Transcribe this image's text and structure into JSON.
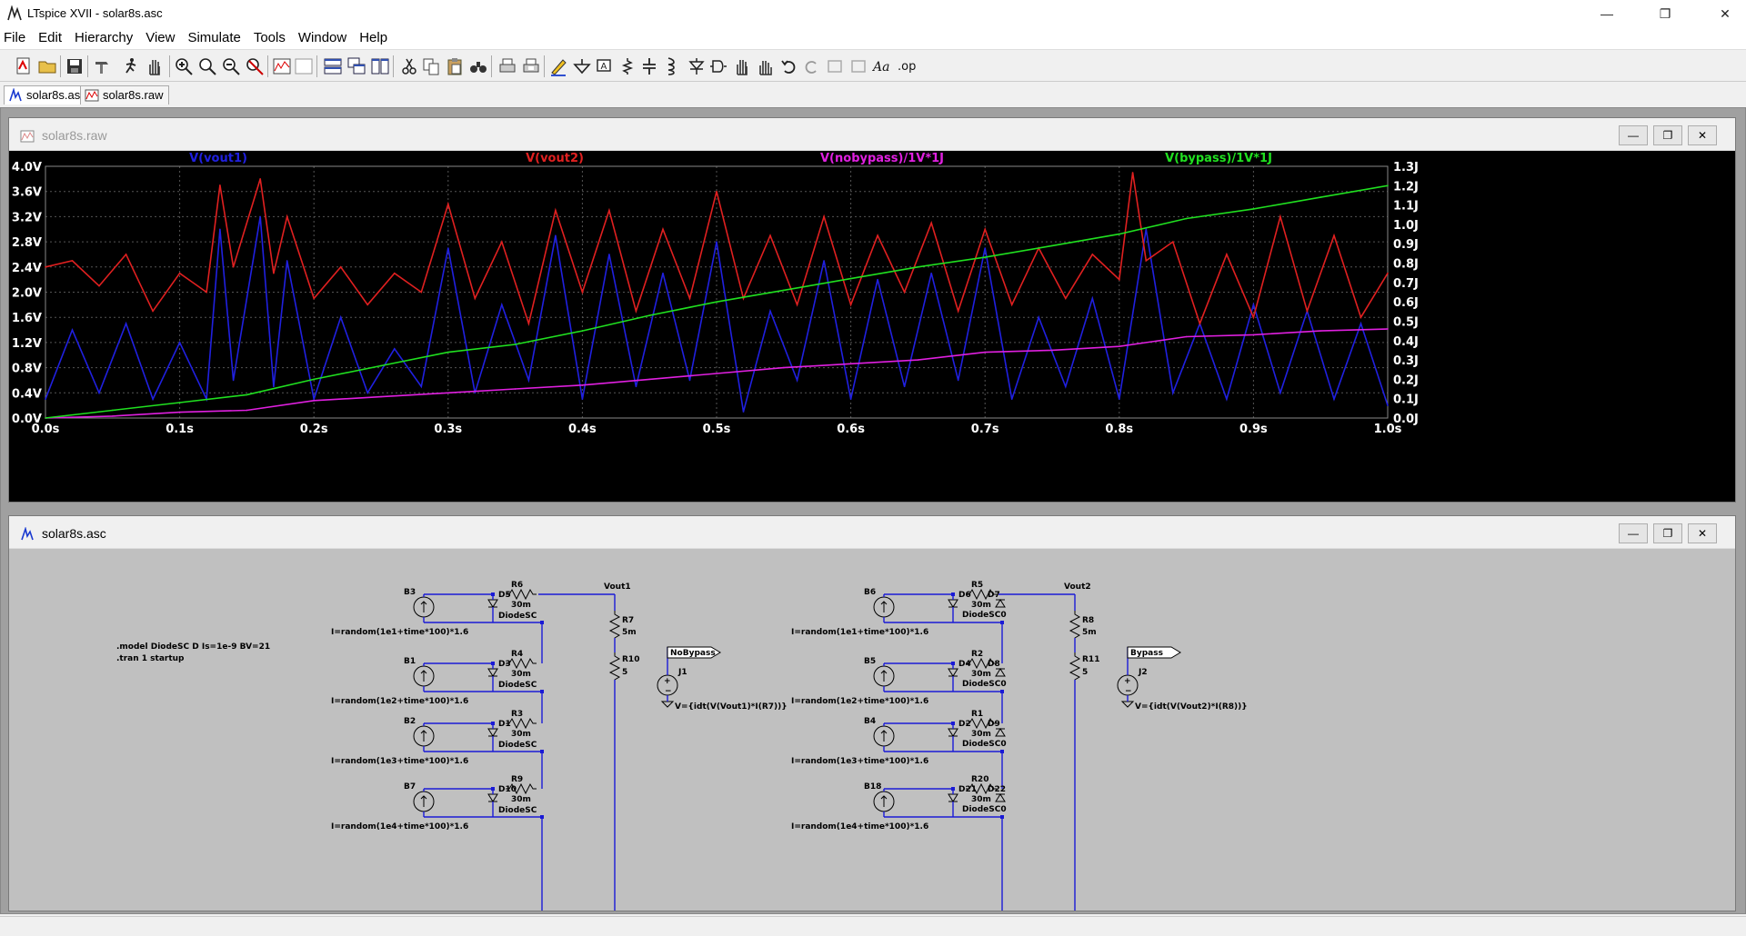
{
  "window": {
    "title": "LTspice XVII - solar8s.asc",
    "controls": {
      "minimize": "—",
      "restore": "❐",
      "close": "✕"
    }
  },
  "menu": [
    "File",
    "Edit",
    "Hierarchy",
    "View",
    "Simulate",
    "Tools",
    "Window",
    "Help"
  ],
  "tabs": [
    {
      "label": "solar8s.asc",
      "icon": "schematic-icon",
      "active": true
    },
    {
      "label": "solar8s.raw",
      "icon": "waveform-icon",
      "active": false
    }
  ],
  "plot_window": {
    "title": "solar8s.raw",
    "controls": {
      "minimize": "—",
      "restore": "❐",
      "close": "✕"
    }
  },
  "schematic_window": {
    "title": "solar8s.asc",
    "controls": {
      "minimize": "—",
      "restore": "❐",
      "close": "✕"
    }
  },
  "chart_data": {
    "type": "line",
    "x_ticks": [
      "0.0s",
      "0.1s",
      "0.2s",
      "0.3s",
      "0.4s",
      "0.5s",
      "0.6s",
      "0.7s",
      "0.8s",
      "0.9s",
      "1.0s"
    ],
    "xlim": [
      0,
      1.0
    ],
    "y_left_ticks": [
      "0.0V",
      "0.4V",
      "0.8V",
      "1.2V",
      "1.6V",
      "2.0V",
      "2.4V",
      "2.8V",
      "3.2V",
      "3.6V",
      "4.0V"
    ],
    "ylim_left": [
      0,
      4.0
    ],
    "y_right_ticks": [
      "0.0J",
      "0.1J",
      "0.2J",
      "0.3J",
      "0.4J",
      "0.5J",
      "0.6J",
      "0.7J",
      "0.8J",
      "0.9J",
      "1.0J",
      "1.1J",
      "1.2J",
      "1.3J"
    ],
    "ylim_right": [
      0,
      1.3
    ],
    "background": "#000000",
    "grid": true,
    "series": [
      {
        "name": "V(vout1)",
        "color": "#2020e0",
        "axis": "left",
        "x": [
          0,
          0.02,
          0.04,
          0.06,
          0.08,
          0.1,
          0.12,
          0.13,
          0.14,
          0.16,
          0.17,
          0.18,
          0.2,
          0.22,
          0.24,
          0.26,
          0.28,
          0.3,
          0.32,
          0.34,
          0.36,
          0.38,
          0.4,
          0.42,
          0.44,
          0.46,
          0.48,
          0.5,
          0.52,
          0.54,
          0.56,
          0.58,
          0.6,
          0.62,
          0.64,
          0.66,
          0.68,
          0.7,
          0.72,
          0.74,
          0.76,
          0.78,
          0.8,
          0.82,
          0.84,
          0.86,
          0.88,
          0.9,
          0.92,
          0.94,
          0.96,
          0.98,
          1.0
        ],
        "y": [
          0.3,
          1.4,
          0.4,
          1.5,
          0.3,
          1.2,
          0.3,
          3.0,
          0.6,
          3.2,
          0.5,
          2.5,
          0.3,
          1.6,
          0.4,
          1.1,
          0.5,
          2.7,
          0.4,
          1.8,
          0.6,
          2.9,
          0.3,
          2.6,
          0.5,
          2.3,
          0.6,
          2.8,
          0.1,
          1.7,
          0.6,
          2.5,
          0.3,
          2.2,
          0.5,
          2.3,
          0.6,
          2.7,
          0.3,
          1.6,
          0.5,
          1.9,
          0.3,
          3.0,
          0.4,
          1.5,
          0.3,
          1.8,
          0.4,
          1.7,
          0.3,
          1.5,
          0.2
        ]
      },
      {
        "name": "V(vout2)",
        "color": "#e02020",
        "axis": "left",
        "x": [
          0,
          0.02,
          0.04,
          0.06,
          0.08,
          0.1,
          0.12,
          0.13,
          0.14,
          0.16,
          0.17,
          0.18,
          0.2,
          0.22,
          0.24,
          0.26,
          0.28,
          0.3,
          0.32,
          0.34,
          0.36,
          0.38,
          0.4,
          0.42,
          0.44,
          0.46,
          0.48,
          0.5,
          0.52,
          0.54,
          0.56,
          0.58,
          0.6,
          0.62,
          0.64,
          0.66,
          0.68,
          0.7,
          0.72,
          0.74,
          0.76,
          0.78,
          0.8,
          0.81,
          0.82,
          0.84,
          0.86,
          0.88,
          0.9,
          0.92,
          0.94,
          0.96,
          0.98,
          1.0
        ],
        "y": [
          2.4,
          2.5,
          2.1,
          2.6,
          1.7,
          2.3,
          2.0,
          3.7,
          2.4,
          3.8,
          2.3,
          3.2,
          1.9,
          2.4,
          1.8,
          2.3,
          2.0,
          3.4,
          1.9,
          2.8,
          1.5,
          3.3,
          2.0,
          3.3,
          1.7,
          3.0,
          1.9,
          3.6,
          1.9,
          2.9,
          1.8,
          3.2,
          1.8,
          2.9,
          2.0,
          3.1,
          1.7,
          3.0,
          1.8,
          2.7,
          1.9,
          2.6,
          2.2,
          3.9,
          2.5,
          2.8,
          1.5,
          2.6,
          1.6,
          3.2,
          1.7,
          2.9,
          1.6,
          2.3
        ]
      },
      {
        "name": "V(nobypass)/1V*1J",
        "color": "#e020e0",
        "axis": "right",
        "x": [
          0,
          0.05,
          0.1,
          0.15,
          0.2,
          0.25,
          0.3,
          0.35,
          0.4,
          0.45,
          0.5,
          0.55,
          0.6,
          0.65,
          0.7,
          0.75,
          0.8,
          0.85,
          0.9,
          0.95,
          1.0
        ],
        "y": [
          0.0,
          0.01,
          0.03,
          0.04,
          0.09,
          0.11,
          0.13,
          0.15,
          0.17,
          0.2,
          0.23,
          0.26,
          0.28,
          0.3,
          0.34,
          0.35,
          0.37,
          0.42,
          0.43,
          0.45,
          0.46
        ]
      },
      {
        "name": "V(bypass)/1V*1J",
        "color": "#20e020",
        "axis": "right",
        "x": [
          0,
          0.05,
          0.1,
          0.15,
          0.2,
          0.25,
          0.3,
          0.35,
          0.4,
          0.45,
          0.5,
          0.55,
          0.6,
          0.65,
          0.7,
          0.75,
          0.8,
          0.85,
          0.9,
          0.95,
          1.0
        ],
        "y": [
          0.0,
          0.04,
          0.08,
          0.12,
          0.2,
          0.27,
          0.34,
          0.38,
          0.45,
          0.53,
          0.6,
          0.66,
          0.72,
          0.78,
          0.83,
          0.89,
          0.95,
          1.03,
          1.08,
          1.14,
          1.2
        ]
      }
    ]
  },
  "schematic": {
    "directives": [
      ".model DiodeSC D Is=1e-9 BV=21",
      ".tran 1 startup"
    ],
    "left_string": {
      "sources": [
        {
          "name": "B3",
          "expr": "I=random(1e1+time*100)*1.6"
        },
        {
          "name": "B1",
          "expr": "I=random(1e2+time*100)*1.6"
        },
        {
          "name": "B2",
          "expr": "I=random(1e3+time*100)*1.6"
        },
        {
          "name": "B7",
          "expr": "I=random(1e4+time*100)*1.6"
        }
      ],
      "diodes": [
        "D5",
        "D3",
        "D1",
        "D10"
      ],
      "diode_model": "DiodeSC",
      "resistors": [
        {
          "name": "R6",
          "value": "30m"
        },
        {
          "name": "R4",
          "value": "30m"
        },
        {
          "name": "R3",
          "value": "30m"
        },
        {
          "name": "R9",
          "value": "30m"
        }
      ],
      "out_net": "Vout1",
      "load": [
        {
          "name": "R7",
          "value": "5m"
        },
        {
          "name": "R10",
          "value": "5"
        }
      ],
      "integrator": {
        "name": "J1",
        "flag": "NoBypass",
        "expr": "V={idt(V(Vout1)*I(R7))}"
      }
    },
    "right_string": {
      "sources": [
        {
          "name": "B6",
          "expr": "I=random(1e1+time*100)*1.6"
        },
        {
          "name": "B5",
          "expr": "I=random(1e2+time*100)*1.6"
        },
        {
          "name": "B4",
          "expr": "I=random(1e3+time*100)*1.6"
        },
        {
          "name": "B18",
          "expr": "I=random(1e4+time*100)*1.6"
        }
      ],
      "diodes": [
        [
          "D6",
          "D7"
        ],
        [
          "D4",
          "D8"
        ],
        [
          "D2",
          "D9"
        ],
        [
          "D21",
          "D22"
        ]
      ],
      "diode_model": "DiodeSC",
      "diode_label_overlap": "DiodeSC0",
      "resistors": [
        {
          "name": "R5",
          "value": "30m"
        },
        {
          "name": "R2",
          "value": "30m"
        },
        {
          "name": "R1",
          "value": "30m"
        },
        {
          "name": "R20",
          "value": "30m"
        }
      ],
      "out_net": "Vout2",
      "load": [
        {
          "name": "R8",
          "value": "5m"
        },
        {
          "name": "R11",
          "value": "5"
        }
      ],
      "integrator": {
        "name": "J2",
        "flag": "Bypass",
        "expr": "V={idt(V(Vout2)*I(R8))}"
      }
    }
  }
}
